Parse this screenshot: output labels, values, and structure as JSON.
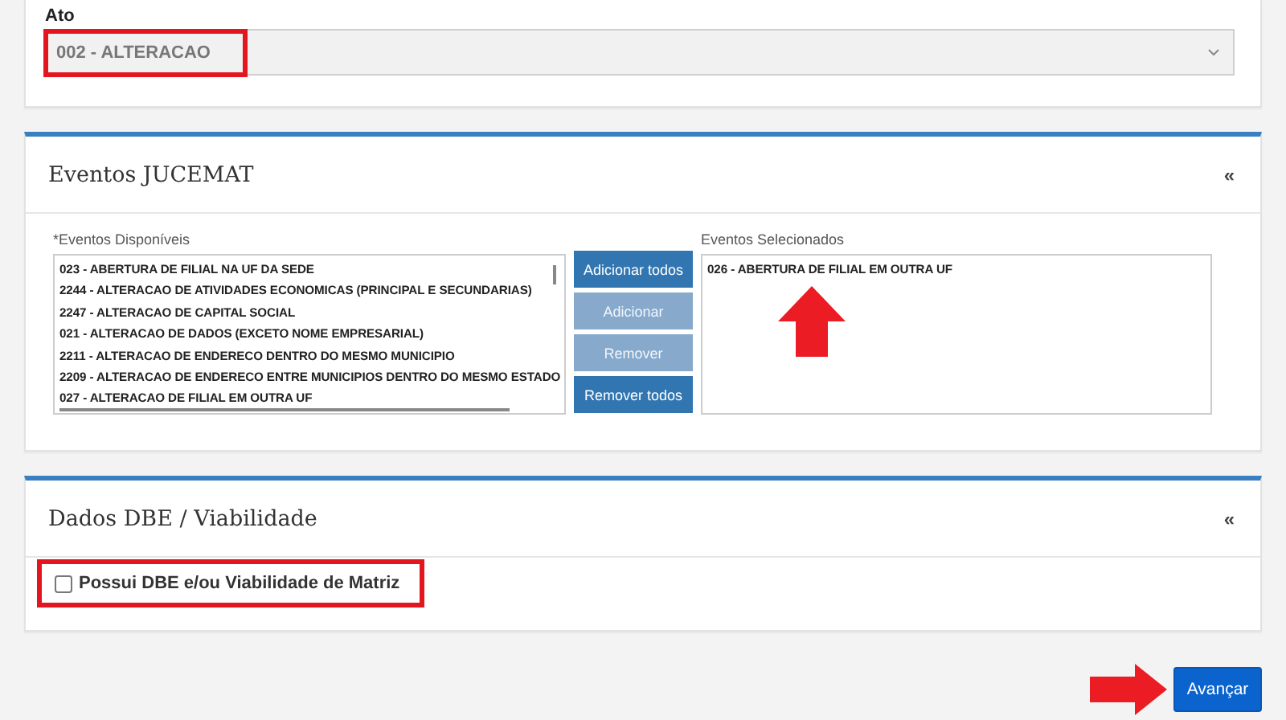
{
  "ato": {
    "label": "Ato",
    "value": "002 - ALTERACAO",
    "highlighted": true
  },
  "eventos": {
    "title": "Eventos JUCEMAT",
    "collapse": "«",
    "available_label": "*Eventos Disponíveis",
    "available": [
      "023 - ABERTURA DE FILIAL NA UF DA SEDE",
      "2244 - ALTERACAO DE ATIVIDADES ECONOMICAS (PRINCIPAL E SECUNDARIAS)",
      "2247 - ALTERACAO DE CAPITAL SOCIAL",
      "021 - ALTERACAO DE DADOS (EXCETO NOME EMPRESARIAL)",
      "2211 - ALTERACAO DE ENDERECO DENTRO DO MESMO MUNICIPIO",
      "2209 - ALTERACAO DE ENDERECO ENTRE MUNICIPIOS DENTRO DO MESMO ESTADO",
      "027 - ALTERACAO DE FILIAL EM OUTRA UF"
    ],
    "buttons": [
      {
        "label": "Adicionar todos",
        "disabled": false
      },
      {
        "label": "Adicionar",
        "disabled": true
      },
      {
        "label": "Remover",
        "disabled": true
      },
      {
        "label": "Remover todos",
        "disabled": false
      }
    ],
    "selected_label": "Eventos Selecionados",
    "selected": [
      "026 - ABERTURA DE FILIAL EM OUTRA UF"
    ],
    "pointer_arrow": true
  },
  "dbe": {
    "title": "Dados DBE / Viabilidade",
    "collapse": "«",
    "checkbox": {
      "label": "Possui DBE e/ou Viabilidade de Matriz",
      "checked": false,
      "highlighted": true
    }
  },
  "next_button": {
    "label": "Avançar",
    "pointer_arrow": true
  }
}
